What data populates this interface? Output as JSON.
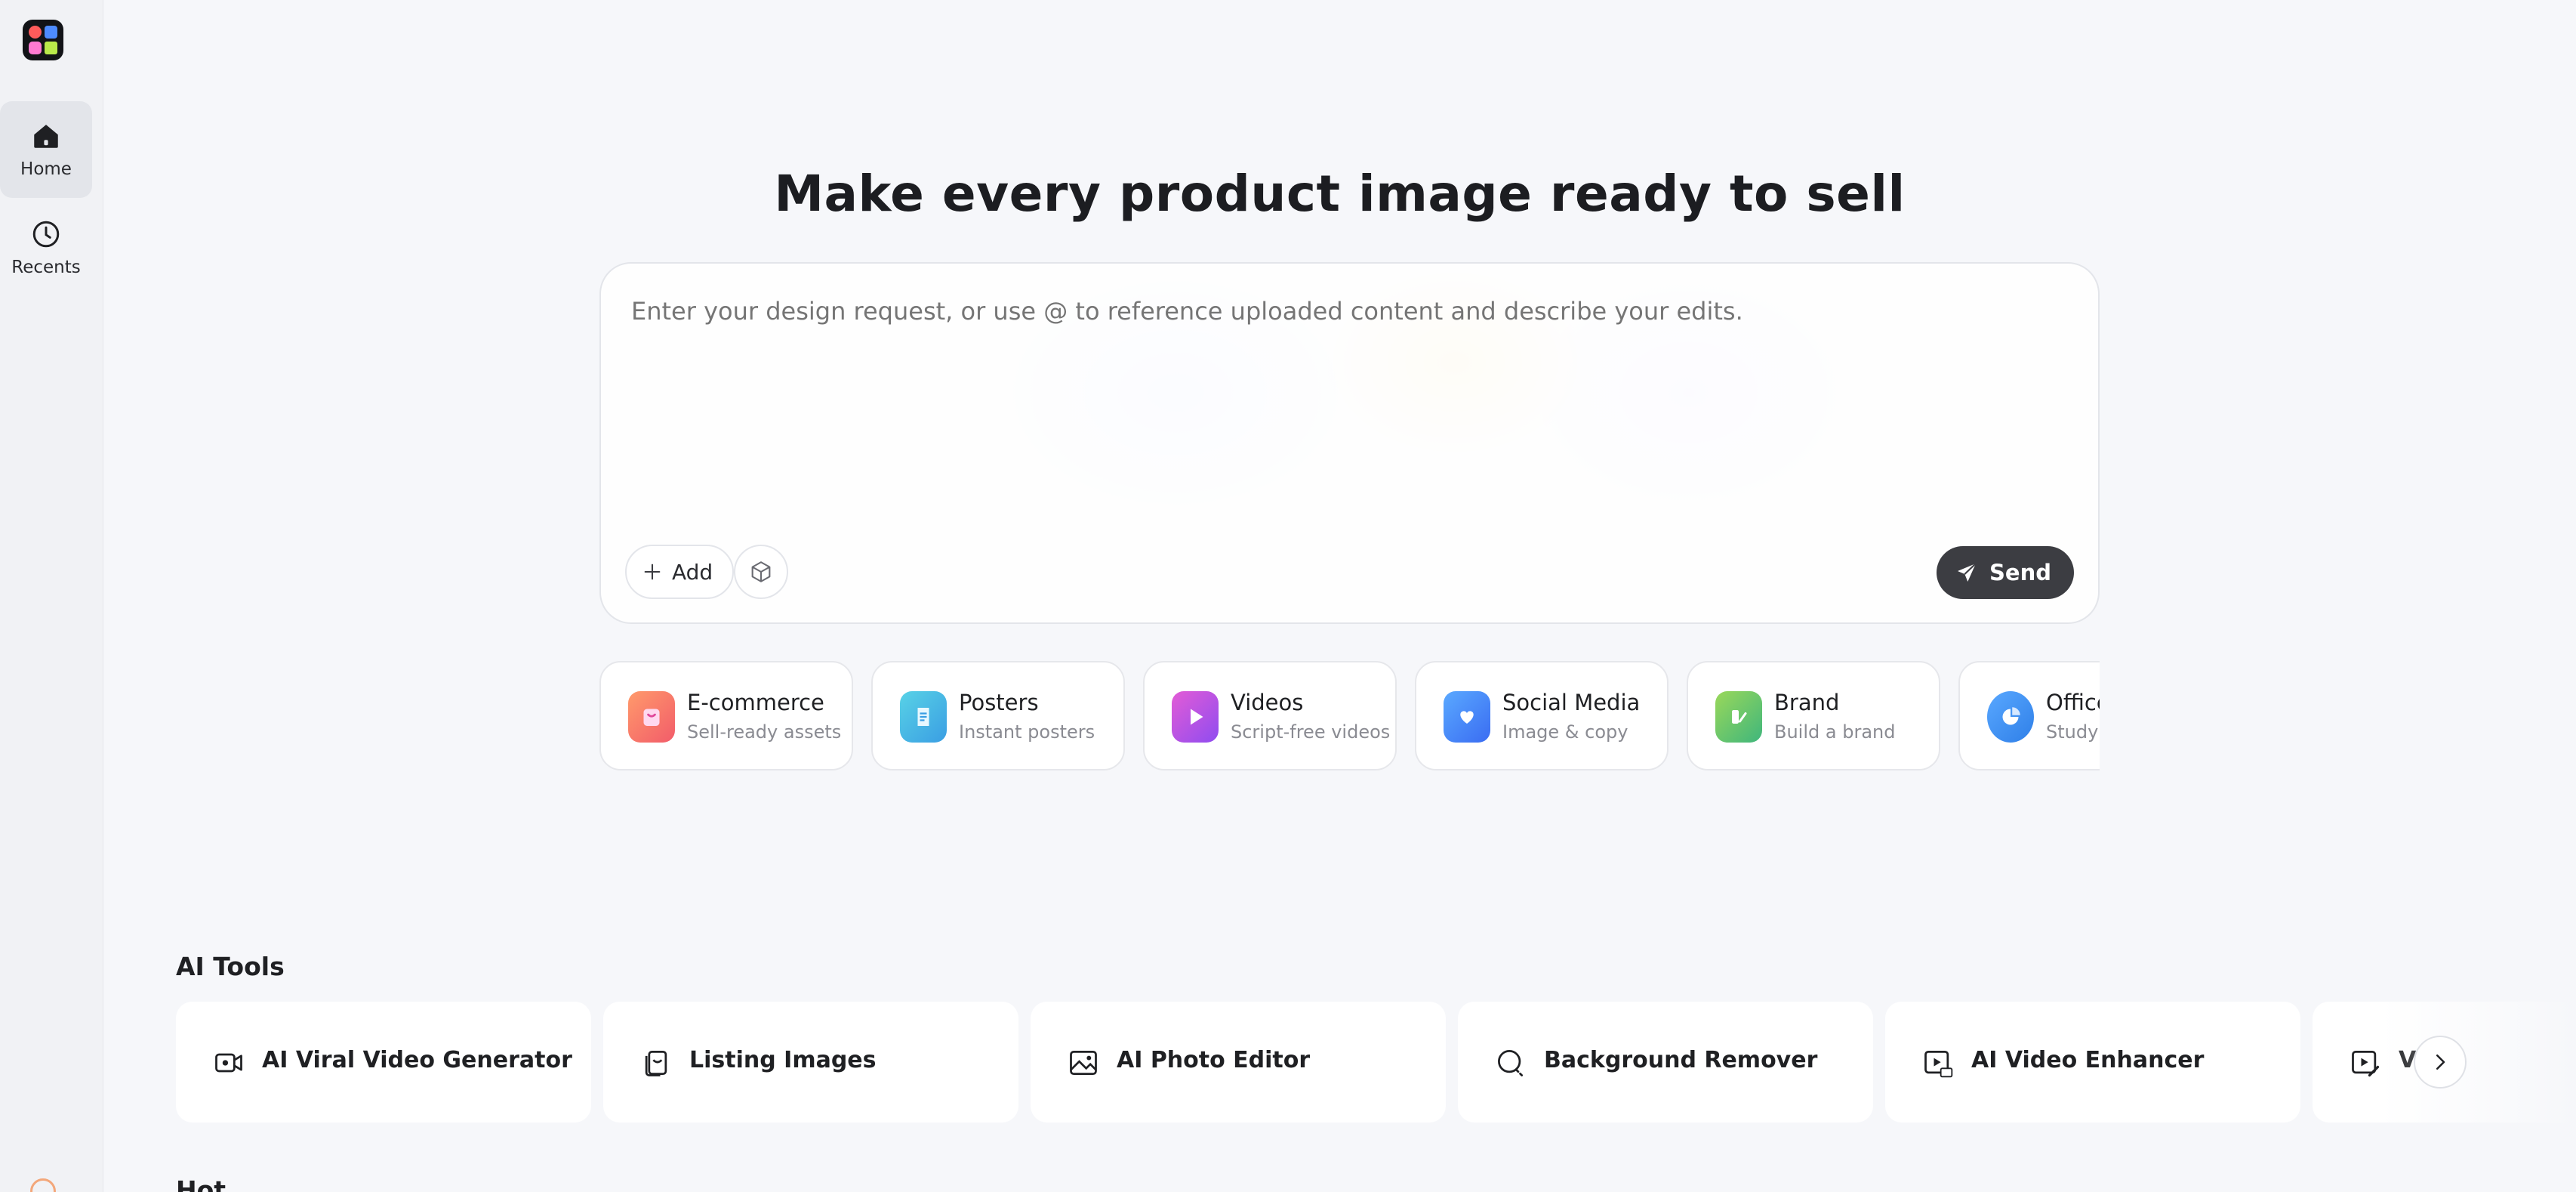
{
  "sidebar": {
    "items": [
      {
        "label": "Home",
        "icon": "home-icon",
        "active": true
      },
      {
        "label": "Recents",
        "icon": "clock-icon",
        "active": false
      }
    ]
  },
  "hero": {
    "title": "Make every product image ready to sell"
  },
  "prompt": {
    "placeholder": "Enter your design request, or use @ to reference uploaded content and describe your edits.",
    "add_label": "Add",
    "send_label": "Send"
  },
  "categories": [
    {
      "title": "E-commerce",
      "subtitle": "Sell-ready assets",
      "icon": "shopping-bag-icon",
      "color": "#f26b4f"
    },
    {
      "title": "Posters",
      "subtitle": "Instant posters",
      "icon": "poster-icon",
      "color": "#3fb7d6"
    },
    {
      "title": "Videos",
      "subtitle": "Script-free videos",
      "icon": "play-icon",
      "color": "#c44be0"
    },
    {
      "title": "Social Media",
      "subtitle": "Image & copy",
      "icon": "heart-chat-icon",
      "color": "#3a86f2"
    },
    {
      "title": "Brand",
      "subtitle": "Build a brand",
      "icon": "brand-icon",
      "color": "#4fc36d"
    },
    {
      "title": "Office",
      "subtitle": "Study",
      "icon": "pie-chart-icon",
      "color": "#3b8ff0"
    }
  ],
  "ai_tools": {
    "title": "AI Tools",
    "items": [
      {
        "label": "AI Viral Video Generator",
        "icon": "video-camera-icon"
      },
      {
        "label": "Listing Images",
        "icon": "listing-images-icon"
      },
      {
        "label": "AI Photo Editor",
        "icon": "photo-edit-icon"
      },
      {
        "label": "Background Remover",
        "icon": "background-remover-icon"
      },
      {
        "label": "AI Video Enhancer",
        "icon": "video-hd-icon"
      },
      {
        "label": "V",
        "icon": "video-edit-icon"
      }
    ]
  },
  "hot": {
    "title": "Hot"
  }
}
